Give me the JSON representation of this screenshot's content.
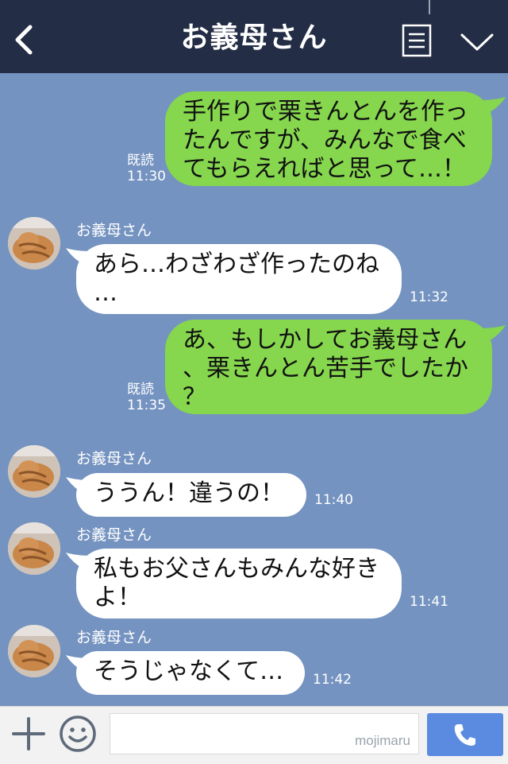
{
  "header": {
    "title": "お義母さん"
  },
  "messages": [
    {
      "direction": "out",
      "lines": [
        "手作りで栗きんとんを作っ",
        "たんですが、みんなで食べ",
        "てもらえればと思って…！"
      ],
      "read": "既読",
      "time": "11:30"
    },
    {
      "direction": "in",
      "sender": "お義母さん",
      "lines": [
        "あら…わざわざ作ったのね",
        "…"
      ],
      "time": "11:32"
    },
    {
      "direction": "out",
      "lines": [
        "あ、もしかしてお義母さん",
        "、栗きんとん苦手でしたか",
        "？"
      ],
      "read": "既読",
      "time": "11:35"
    },
    {
      "direction": "in",
      "sender": "お義母さん",
      "lines": [
        "ううん！違うの！"
      ],
      "time": "11:40"
    },
    {
      "direction": "in",
      "sender": "お義母さん",
      "lines": [
        "私もお父さんもみんな好き",
        "よ！"
      ],
      "time": "11:41"
    },
    {
      "direction": "in",
      "sender": "お義母さん",
      "lines": [
        "そうじゃなくて…"
      ],
      "time": "11:42"
    }
  ],
  "input": {
    "value": "",
    "watermark": "mojimaru"
  },
  "colors": {
    "background": "#7493c0",
    "header": "#232d45",
    "outgoing_bubble": "#86d64e",
    "incoming_bubble": "#ffffff",
    "call_button": "#5a8be0"
  },
  "icons": [
    "back-icon",
    "menu-icon",
    "chevron-down-icon",
    "plus-icon",
    "emoji-icon",
    "phone-icon"
  ]
}
